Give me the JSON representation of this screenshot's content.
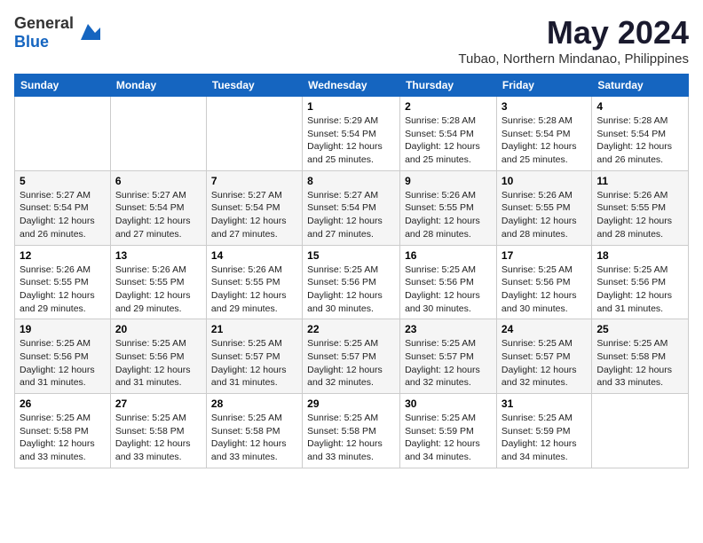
{
  "header": {
    "logo_general": "General",
    "logo_blue": "Blue",
    "month_title": "May 2024",
    "location": "Tubao, Northern Mindanao, Philippines"
  },
  "days_of_week": [
    "Sunday",
    "Monday",
    "Tuesday",
    "Wednesday",
    "Thursday",
    "Friday",
    "Saturday"
  ],
  "weeks": [
    [
      {
        "day": "",
        "info": ""
      },
      {
        "day": "",
        "info": ""
      },
      {
        "day": "",
        "info": ""
      },
      {
        "day": "1",
        "info": "Sunrise: 5:29 AM\nSunset: 5:54 PM\nDaylight: 12 hours\nand 25 minutes."
      },
      {
        "day": "2",
        "info": "Sunrise: 5:28 AM\nSunset: 5:54 PM\nDaylight: 12 hours\nand 25 minutes."
      },
      {
        "day": "3",
        "info": "Sunrise: 5:28 AM\nSunset: 5:54 PM\nDaylight: 12 hours\nand 25 minutes."
      },
      {
        "day": "4",
        "info": "Sunrise: 5:28 AM\nSunset: 5:54 PM\nDaylight: 12 hours\nand 26 minutes."
      }
    ],
    [
      {
        "day": "5",
        "info": "Sunrise: 5:27 AM\nSunset: 5:54 PM\nDaylight: 12 hours\nand 26 minutes."
      },
      {
        "day": "6",
        "info": "Sunrise: 5:27 AM\nSunset: 5:54 PM\nDaylight: 12 hours\nand 27 minutes."
      },
      {
        "day": "7",
        "info": "Sunrise: 5:27 AM\nSunset: 5:54 PM\nDaylight: 12 hours\nand 27 minutes."
      },
      {
        "day": "8",
        "info": "Sunrise: 5:27 AM\nSunset: 5:54 PM\nDaylight: 12 hours\nand 27 minutes."
      },
      {
        "day": "9",
        "info": "Sunrise: 5:26 AM\nSunset: 5:55 PM\nDaylight: 12 hours\nand 28 minutes."
      },
      {
        "day": "10",
        "info": "Sunrise: 5:26 AM\nSunset: 5:55 PM\nDaylight: 12 hours\nand 28 minutes."
      },
      {
        "day": "11",
        "info": "Sunrise: 5:26 AM\nSunset: 5:55 PM\nDaylight: 12 hours\nand 28 minutes."
      }
    ],
    [
      {
        "day": "12",
        "info": "Sunrise: 5:26 AM\nSunset: 5:55 PM\nDaylight: 12 hours\nand 29 minutes."
      },
      {
        "day": "13",
        "info": "Sunrise: 5:26 AM\nSunset: 5:55 PM\nDaylight: 12 hours\nand 29 minutes."
      },
      {
        "day": "14",
        "info": "Sunrise: 5:26 AM\nSunset: 5:55 PM\nDaylight: 12 hours\nand 29 minutes."
      },
      {
        "day": "15",
        "info": "Sunrise: 5:25 AM\nSunset: 5:56 PM\nDaylight: 12 hours\nand 30 minutes."
      },
      {
        "day": "16",
        "info": "Sunrise: 5:25 AM\nSunset: 5:56 PM\nDaylight: 12 hours\nand 30 minutes."
      },
      {
        "day": "17",
        "info": "Sunrise: 5:25 AM\nSunset: 5:56 PM\nDaylight: 12 hours\nand 30 minutes."
      },
      {
        "day": "18",
        "info": "Sunrise: 5:25 AM\nSunset: 5:56 PM\nDaylight: 12 hours\nand 31 minutes."
      }
    ],
    [
      {
        "day": "19",
        "info": "Sunrise: 5:25 AM\nSunset: 5:56 PM\nDaylight: 12 hours\nand 31 minutes."
      },
      {
        "day": "20",
        "info": "Sunrise: 5:25 AM\nSunset: 5:56 PM\nDaylight: 12 hours\nand 31 minutes."
      },
      {
        "day": "21",
        "info": "Sunrise: 5:25 AM\nSunset: 5:57 PM\nDaylight: 12 hours\nand 31 minutes."
      },
      {
        "day": "22",
        "info": "Sunrise: 5:25 AM\nSunset: 5:57 PM\nDaylight: 12 hours\nand 32 minutes."
      },
      {
        "day": "23",
        "info": "Sunrise: 5:25 AM\nSunset: 5:57 PM\nDaylight: 12 hours\nand 32 minutes."
      },
      {
        "day": "24",
        "info": "Sunrise: 5:25 AM\nSunset: 5:57 PM\nDaylight: 12 hours\nand 32 minutes."
      },
      {
        "day": "25",
        "info": "Sunrise: 5:25 AM\nSunset: 5:58 PM\nDaylight: 12 hours\nand 33 minutes."
      }
    ],
    [
      {
        "day": "26",
        "info": "Sunrise: 5:25 AM\nSunset: 5:58 PM\nDaylight: 12 hours\nand 33 minutes."
      },
      {
        "day": "27",
        "info": "Sunrise: 5:25 AM\nSunset: 5:58 PM\nDaylight: 12 hours\nand 33 minutes."
      },
      {
        "day": "28",
        "info": "Sunrise: 5:25 AM\nSunset: 5:58 PM\nDaylight: 12 hours\nand 33 minutes."
      },
      {
        "day": "29",
        "info": "Sunrise: 5:25 AM\nSunset: 5:58 PM\nDaylight: 12 hours\nand 33 minutes."
      },
      {
        "day": "30",
        "info": "Sunrise: 5:25 AM\nSunset: 5:59 PM\nDaylight: 12 hours\nand 34 minutes."
      },
      {
        "day": "31",
        "info": "Sunrise: 5:25 AM\nSunset: 5:59 PM\nDaylight: 12 hours\nand 34 minutes."
      },
      {
        "day": "",
        "info": ""
      }
    ]
  ]
}
